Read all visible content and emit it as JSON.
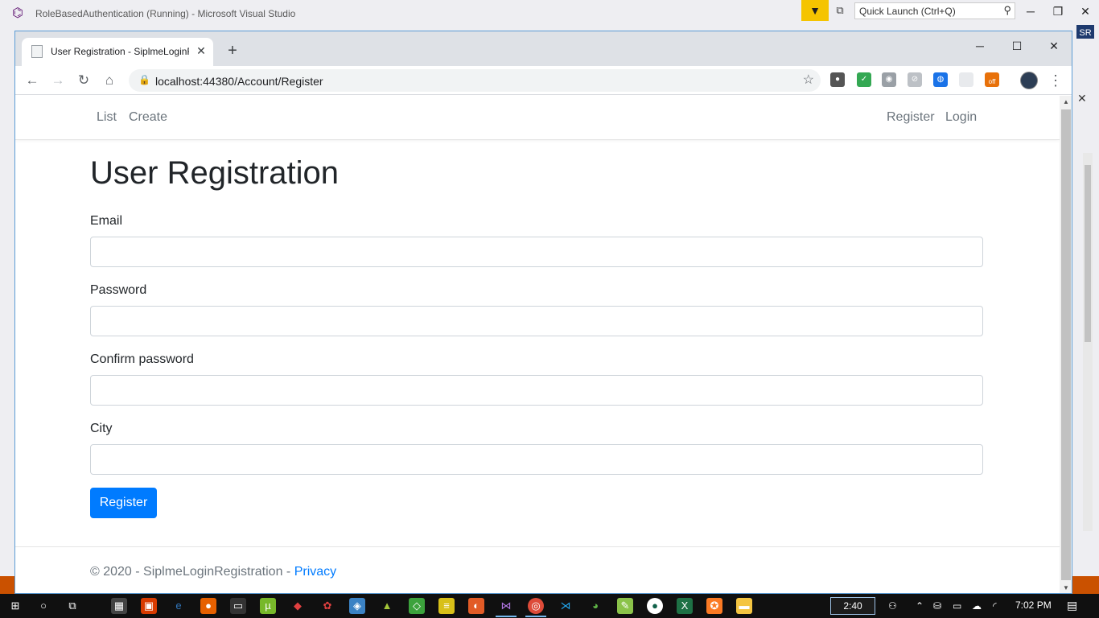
{
  "vs": {
    "title": "RoleBasedAuthentication (Running) - Microsoft Visual Studio",
    "quick_launch_placeholder": "Quick Launch (Ctrl+Q)",
    "user_initials": "SR"
  },
  "browser": {
    "tab_title": "User Registration - SiplmeLoginRegistration",
    "url": "localhost:44380/Account/Register",
    "extension_badge": "off"
  },
  "site": {
    "nav_left": [
      "List",
      "Create"
    ],
    "nav_right": [
      "Register",
      "Login"
    ],
    "page_title": "User Registration",
    "form": {
      "fields": [
        {
          "label": "Email",
          "value": ""
        },
        {
          "label": "Password",
          "value": ""
        },
        {
          "label": "Confirm password",
          "value": ""
        },
        {
          "label": "City",
          "value": ""
        }
      ],
      "submit_label": "Register"
    },
    "footer": {
      "text": "© 2020 - SiplmeLoginRegistration - ",
      "privacy_link": "Privacy"
    }
  },
  "taskbar": {
    "timer": "2:40",
    "clock": "7:02 PM"
  },
  "colors": {
    "primary": "#007bff",
    "muted_text": "#6c757d",
    "vs_status": "#ca5100",
    "vs_filter": "#f5c400"
  }
}
